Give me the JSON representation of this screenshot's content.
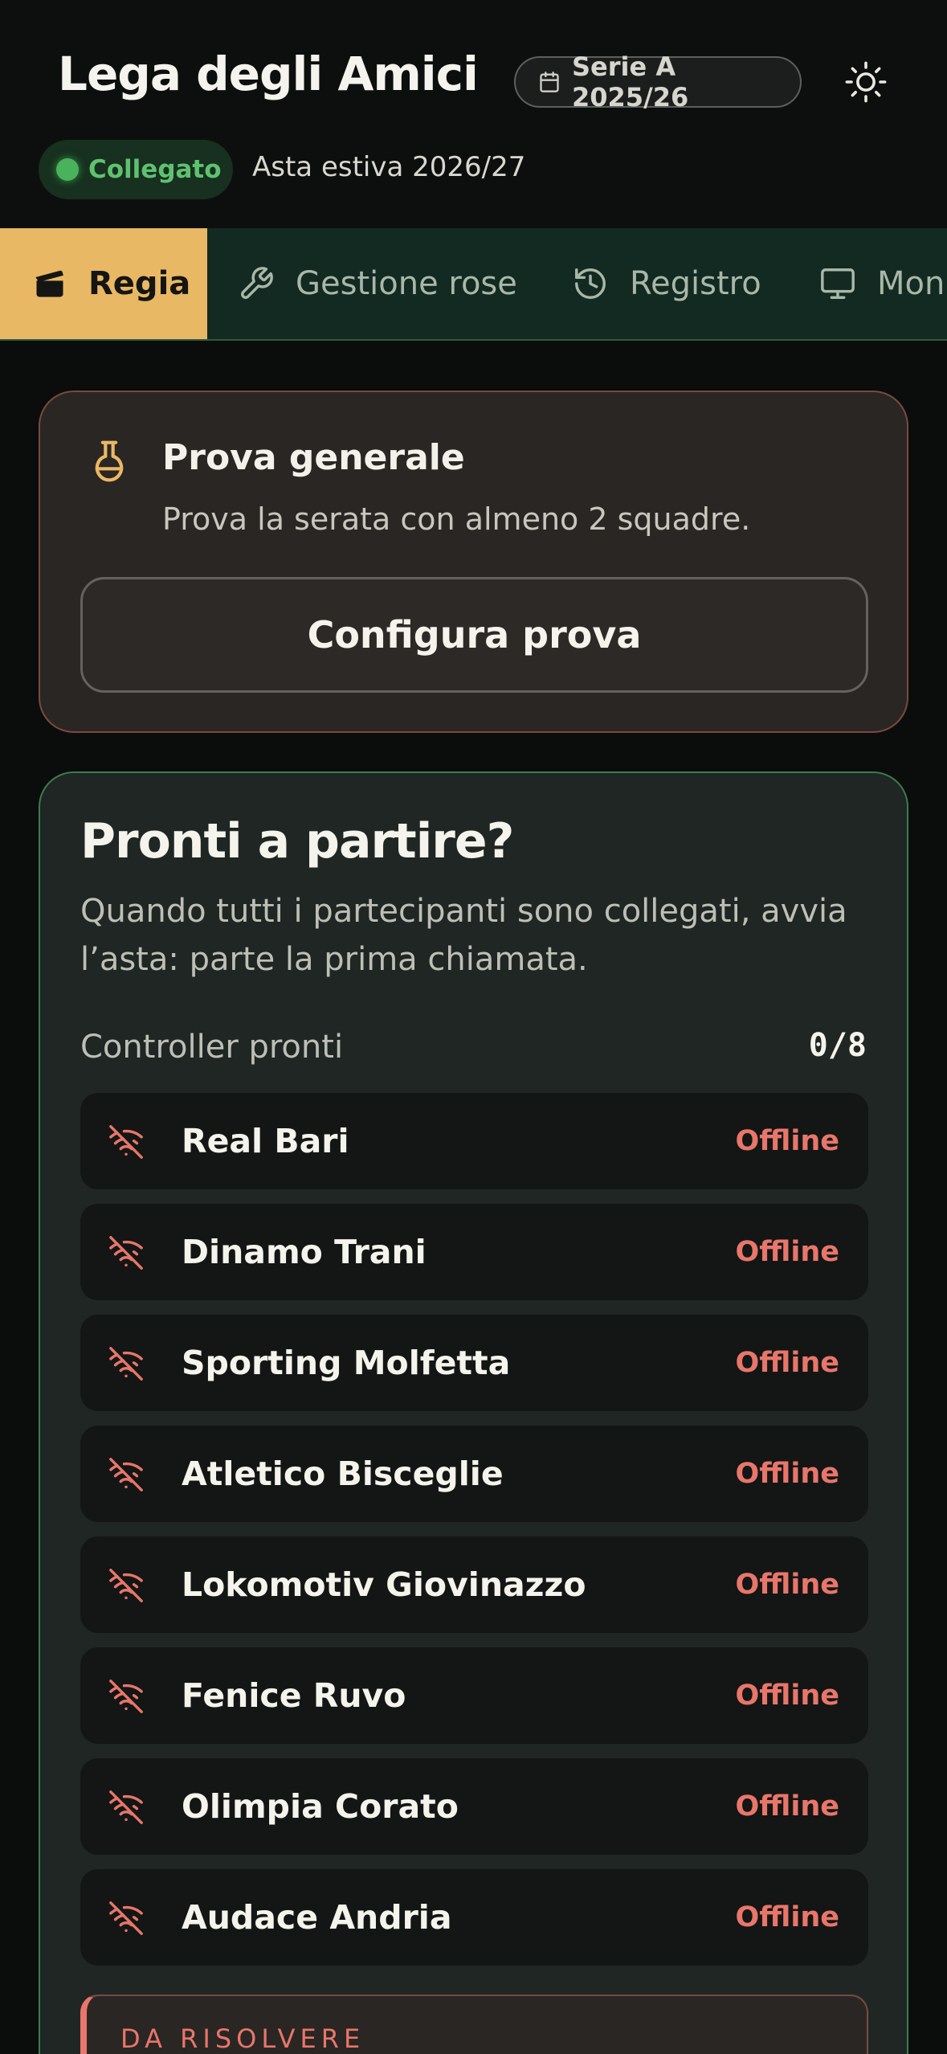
{
  "header": {
    "title": "Lega degli Amici",
    "season": "Serie A 2025/26",
    "connection_status": "Collegato",
    "session": "Asta estiva 2026/27"
  },
  "tabs": [
    {
      "label": "Regia",
      "icon": "clapperboard-icon",
      "active": true
    },
    {
      "label": "Gestione rose",
      "icon": "wrench-icon",
      "active": false
    },
    {
      "label": "Registro",
      "icon": "history-icon",
      "active": false
    },
    {
      "label": "Mon",
      "icon": "monitor-icon",
      "active": false
    }
  ],
  "rehearsal": {
    "title": "Prova generale",
    "text": "Prova la serata con almeno 2 squadre.",
    "button": "Configura prova"
  },
  "ready": {
    "title": "Pronti a partire?",
    "text": "Quando tutti i partecipanti sono collegati, avvia l’asta: parte la prima chiamata.",
    "controllers_label": "Controller pronti",
    "controllers_count": "0/8",
    "teams": [
      {
        "name": "Real Bari",
        "status": "Offline"
      },
      {
        "name": "Dinamo Trani",
        "status": "Offline"
      },
      {
        "name": "Sporting Molfetta",
        "status": "Offline"
      },
      {
        "name": "Atletico Bisceglie",
        "status": "Offline"
      },
      {
        "name": "Lokomotiv Giovinazzo",
        "status": "Offline"
      },
      {
        "name": "Fenice Ruvo",
        "status": "Offline"
      },
      {
        "name": "Olimpia Corato",
        "status": "Offline"
      },
      {
        "name": "Audace Andria",
        "status": "Offline"
      }
    ],
    "todo_label": "DA RISOLVERE"
  },
  "colors": {
    "accent": "#e9b865",
    "online": "#49b35c",
    "offline": "#e8766a",
    "tabbar": "#122a22"
  }
}
